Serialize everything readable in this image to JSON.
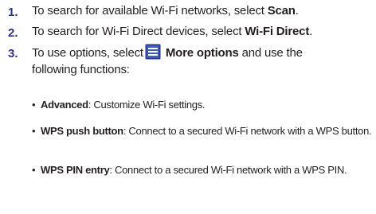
{
  "steps": [
    {
      "number": "1.",
      "prefix": "To search for available Wi-Fi networks, select ",
      "bold": "Scan",
      "suffix": "."
    },
    {
      "number": "2.",
      "prefix": "To search for Wi-Fi Direct devices, select ",
      "bold": "Wi-Fi Direct",
      "suffix": "."
    },
    {
      "number": "3.",
      "prefix": "To use options, select",
      "icon": "menu-icon",
      "bold": "More options",
      "suffix": " and use the",
      "continuation": "following functions:"
    }
  ],
  "functions": [
    {
      "bullet": "•",
      "name": "Advanced",
      "description": ": Customize Wi-Fi settings."
    },
    {
      "bullet": "•",
      "name": "WPS push button",
      "description": ": Connect to a secured Wi-Fi network with a WPS button."
    },
    {
      "bullet": "•",
      "name": "WPS PIN entry",
      "description": ": Connect to a secured Wi-Fi network with a WPS PIN."
    }
  ],
  "colors": {
    "step_number": "#2e3192",
    "text": "#231f20",
    "icon_fill": "#2e3192"
  }
}
